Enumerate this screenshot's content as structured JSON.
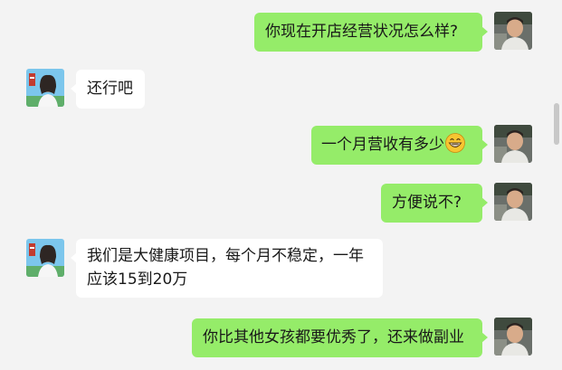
{
  "messages": [
    {
      "side": "me",
      "text": "你现在开店经营状况怎么样?"
    },
    {
      "side": "other",
      "text": "还行吧"
    },
    {
      "side": "me",
      "text": "一个月营收有多少",
      "emoji": "grinning-face-emoji"
    },
    {
      "side": "me",
      "text": "方便说不?"
    },
    {
      "side": "other",
      "lines": [
        "我们是大健康项目，每个月不稳定，一年",
        "应该15到20万"
      ]
    },
    {
      "side": "me",
      "text": "你比其他女孩都要优秀了，还来做副业"
    }
  ],
  "colors": {
    "background": "#f3f3f3",
    "my_bubble": "#95ec69",
    "their_bubble": "#ffffff",
    "text": "#191919"
  }
}
